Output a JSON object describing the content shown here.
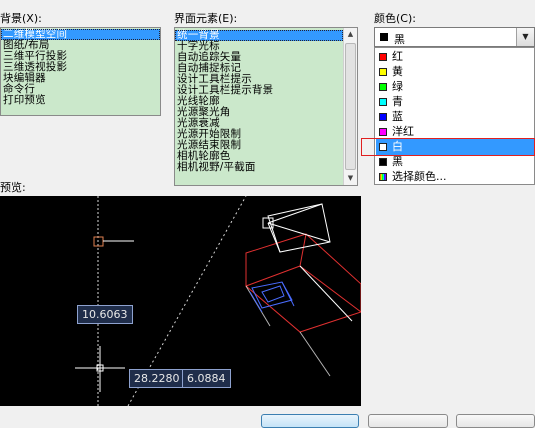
{
  "context_label": "背景(X):",
  "context_items": [
    "二维模型空间",
    "图纸/布局",
    "三维平行投影",
    "三维透视投影",
    "块编辑器",
    "命令行",
    "打印预览"
  ],
  "context_selected": 0,
  "element_label": "界面元素(E):",
  "element_items": [
    "统一背景",
    "十字光标",
    "自动追踪矢量",
    "自动捕捉标记",
    "设计工具栏提示",
    "设计工具栏提示背景",
    "光线轮廓",
    "光源聚光角",
    "光源衰减",
    "光源开始限制",
    "光源结束限制",
    "相机轮廓色",
    "相机视野/平截面"
  ],
  "element_selected": 0,
  "color_label": "颜色(C):",
  "color_current": {
    "label": "黑",
    "hex": "#000000"
  },
  "color_options": [
    {
      "label": "红",
      "hex": "#ff0000"
    },
    {
      "label": "黄",
      "hex": "#ffff00"
    },
    {
      "label": "绿",
      "hex": "#00ff00"
    },
    {
      "label": "青",
      "hex": "#00ffff"
    },
    {
      "label": "蓝",
      "hex": "#0000ff"
    },
    {
      "label": "洋红",
      "hex": "#ff00ff"
    },
    {
      "label": "白",
      "hex": "#ffffff"
    },
    {
      "label": "黑",
      "hex": "#000000"
    },
    {
      "label": "选择颜色...",
      "icon": "palette-icon"
    }
  ],
  "color_selected": 6,
  "preview_label": "预览:",
  "preview": {
    "dim_vertical": "10.6063",
    "dim_x": "28.2280",
    "dim_y": "6.0884"
  },
  "accent_colors": {
    "selection": "#3399ff",
    "list_bg": "#cbe8cb",
    "highlight_red": "#e02020"
  }
}
